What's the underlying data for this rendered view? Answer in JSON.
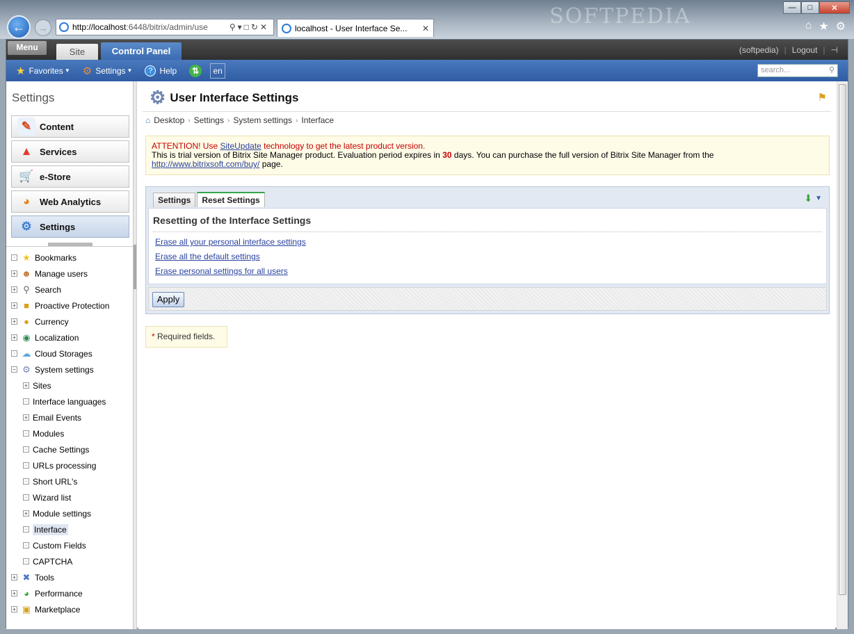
{
  "browser": {
    "address": "http://localhost:6448/bitrix/admin/use",
    "address_host": "http://localhost",
    "address_rest": ":6448/bitrix/admin/use",
    "tab_title": "localhost - User Interface Se...",
    "watermark": "SOFTPEDIA"
  },
  "top": {
    "menu": "Menu",
    "site_tab": "Site",
    "control_panel_tab": "Control Panel",
    "user": "(softpedia)",
    "logout": "Logout"
  },
  "toolbar": {
    "favorites": "Favorites",
    "settings": "Settings",
    "help": "Help",
    "lang": "en",
    "search_placeholder": "search..."
  },
  "sidebar": {
    "title": "Settings",
    "buttons": [
      {
        "label": "Content"
      },
      {
        "label": "Services"
      },
      {
        "label": "e-Store"
      },
      {
        "label": "Web Analytics"
      },
      {
        "label": "Settings"
      }
    ],
    "tree": [
      {
        "label": "Bookmarks",
        "level": 1,
        "box": "·"
      },
      {
        "label": "Manage users",
        "level": 1,
        "box": "+"
      },
      {
        "label": "Search",
        "level": 1,
        "box": "+"
      },
      {
        "label": "Proactive Protection",
        "level": 1,
        "box": "+"
      },
      {
        "label": "Currency",
        "level": 1,
        "box": "+"
      },
      {
        "label": "Localization",
        "level": 1,
        "box": "+"
      },
      {
        "label": "Cloud Storages",
        "level": 1,
        "box": "·"
      },
      {
        "label": "System settings",
        "level": 1,
        "box": "−"
      },
      {
        "label": "Sites",
        "level": 2,
        "box": "+"
      },
      {
        "label": "Interface languages",
        "level": 2,
        "box": "·"
      },
      {
        "label": "Email Events",
        "level": 2,
        "box": "+"
      },
      {
        "label": "Modules",
        "level": 2,
        "box": "·"
      },
      {
        "label": "Cache Settings",
        "level": 2,
        "box": "·"
      },
      {
        "label": "URLs processing",
        "level": 2,
        "box": "·"
      },
      {
        "label": "Short URL's",
        "level": 2,
        "box": "·"
      },
      {
        "label": "Wizard list",
        "level": 2,
        "box": "·"
      },
      {
        "label": "Module settings",
        "level": 2,
        "box": "+"
      },
      {
        "label": "Interface",
        "level": 2,
        "box": "·"
      },
      {
        "label": "Custom Fields",
        "level": 2,
        "box": "·"
      },
      {
        "label": "CAPTCHA",
        "level": 2,
        "box": "·"
      },
      {
        "label": "Tools",
        "level": 1,
        "box": "+"
      },
      {
        "label": "Performance",
        "level": 1,
        "box": "+"
      },
      {
        "label": "Marketplace",
        "level": 1,
        "box": "+"
      }
    ]
  },
  "page": {
    "title": "User Interface Settings",
    "breadcrumb": [
      "Desktop",
      "Settings",
      "System settings",
      "Interface"
    ],
    "notice": {
      "attention_prefix": "ATTENTION! Use ",
      "siteupdate_link": "SiteUpdate",
      "attention_suffix": " technology to get the latest product version.",
      "trial_prefix": "This is trial version of Bitrix Site Manager product. Evaluation period expires in ",
      "days": "30",
      "trial_suffix": " days. You can purchase the full version of Bitrix Site Manager from the",
      "buy_link": "http://www.bitrixsoft.com/buy/",
      "page_word": " page."
    },
    "tabs": [
      "Settings",
      "Reset Settings"
    ],
    "section_title": "Resetting of the Interface Settings",
    "links": [
      "Erase all your personal interface settings",
      "Erase all the default settings",
      "Erase personal settings for all users"
    ],
    "apply": "Apply",
    "required": "Required fields.",
    "required_star": "*"
  }
}
